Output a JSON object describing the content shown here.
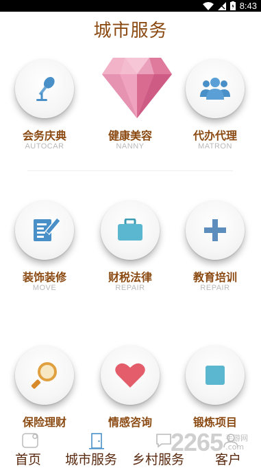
{
  "status_bar": {
    "time": "8:43"
  },
  "page_title": "城市服务",
  "grid": [
    {
      "title": "会务庆典",
      "subtitle": "AUTOCAR",
      "icon": "microphone-icon"
    },
    {
      "title": "健康美容",
      "subtitle": "NANNY",
      "icon": "diamond-icon"
    },
    {
      "title": "代办代理",
      "subtitle": "MATRON",
      "icon": "group-icon"
    },
    {
      "title": "装饰装修",
      "subtitle": "MOVE",
      "icon": "edit-document-icon"
    },
    {
      "title": "财税法律",
      "subtitle": "REPAIR",
      "icon": "briefcase-icon"
    },
    {
      "title": "教育培训",
      "subtitle": "REPAIR",
      "icon": "plus-icon"
    },
    {
      "title": "保险理财",
      "subtitle": "",
      "icon": "search-icon"
    },
    {
      "title": "情感咨询",
      "subtitle": "",
      "icon": "heart-icon"
    },
    {
      "title": "锻炼项目",
      "subtitle": "",
      "icon": "square-icon"
    }
  ],
  "bottom_nav": [
    {
      "label": "首页",
      "icon": "home-icon"
    },
    {
      "label": "城市服务",
      "icon": "door-icon"
    },
    {
      "label": "乡村服务",
      "icon": "chat-icon"
    },
    {
      "label": "客户",
      "icon": "user-icon"
    }
  ],
  "watermark": {
    "number": "2265",
    "suffix": ".com",
    "site": "手游网"
  },
  "colors": {
    "title": "#8B4A12",
    "subtitle": "#b8b8b8",
    "icon_blue": "#4a90c8",
    "heart": "#e35d6a",
    "diamond": "#e07a9c"
  }
}
